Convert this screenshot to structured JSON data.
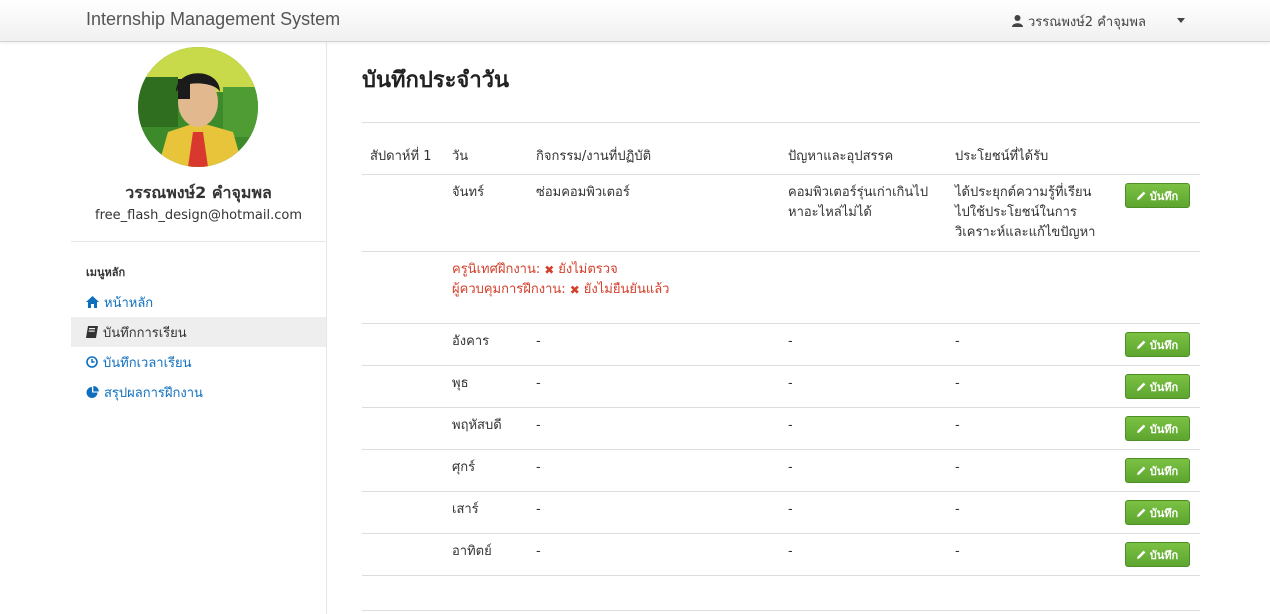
{
  "navbar": {
    "brand": "Internship Management System",
    "user_name": "วรรณพงษ์2 คำจุมพล"
  },
  "profile": {
    "name": "วรรณพงษ์2 คำจุมพล",
    "email": "free_flash_design@hotmail.com"
  },
  "sidebar": {
    "header": "เมนูหลัก",
    "items": [
      {
        "label": "หน้าหลัก",
        "icon": "home-icon",
        "active": false
      },
      {
        "label": "บันทึกการเรียน",
        "icon": "book-icon",
        "active": true
      },
      {
        "label": "บันทึกเวลาเรียน",
        "icon": "clock-icon",
        "active": false
      },
      {
        "label": "สรุปผลการฝึกงาน",
        "icon": "pie-chart-icon",
        "active": false
      }
    ]
  },
  "main": {
    "title": "บันทึกประจำวัน",
    "week_label": "สัปดาห์ที่ 1",
    "columns": {
      "day": "วัน",
      "activity": "กิจกรรม/งานที่ปฏิบัติ",
      "problems": "ปัญหาและอุปสรรค",
      "benefits": "ประโยชน์ที่ได้รับ"
    },
    "save_label": "บันทึก",
    "rows": [
      {
        "day": "จันทร์",
        "activity": "ซ่อมคอมพิวเตอร์",
        "problems": [
          "คอมพิวเตอร์รุ่นเก่าเกินไป",
          "หาอะไหล่ไม่ได้"
        ],
        "benefits": [
          "ได้ประยุกต์ความรู้ที่เรียน",
          "ไปใช้ประโยชน์ในการ",
          "วิเคราะห์และแก้ไขปัญหา"
        ]
      },
      {
        "day": "อังคาร",
        "activity": "-",
        "problems": "-",
        "benefits": "-"
      },
      {
        "day": "พุธ",
        "activity": "-",
        "problems": "-",
        "benefits": "-"
      },
      {
        "day": "พฤหัสบดี",
        "activity": "-",
        "problems": "-",
        "benefits": "-"
      },
      {
        "day": "ศุกร์",
        "activity": "-",
        "problems": "-",
        "benefits": "-"
      },
      {
        "day": "เสาร์",
        "activity": "-",
        "problems": "-",
        "benefits": "-"
      },
      {
        "day": "อาทิตย์",
        "activity": "-",
        "problems": "-",
        "benefits": "-"
      }
    ],
    "status": {
      "teacher_label": "ครูนิเทศฝึกงาน:",
      "teacher_value": "ยังไม่ตรวจ",
      "supervisor_label": "ผู้ควบคุมการฝึกงาน:",
      "supervisor_value": "ยังไม่ยืนยันแล้ว"
    }
  },
  "colors": {
    "link": "#0f6fbf",
    "success": "#5ea52f",
    "danger": "#d43f2a"
  }
}
